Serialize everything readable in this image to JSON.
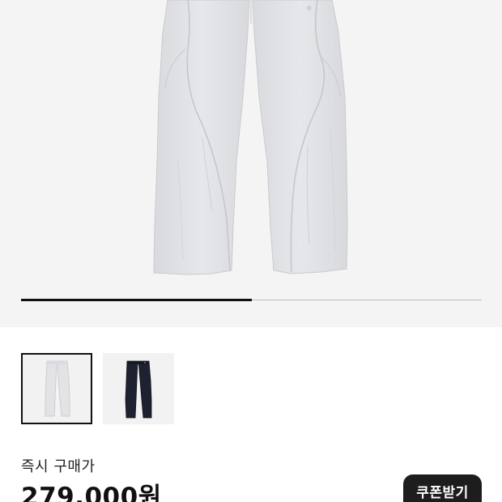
{
  "product": {
    "gallery": {
      "progress_fraction": 0.5,
      "main_image_icon": "light-gray-pants-image",
      "thumbnails": [
        {
          "name": "light-gray-pants-thumbnail",
          "color": "#e3e3e6",
          "selected": true
        },
        {
          "name": "navy-pants-thumbnail",
          "color": "#1e2130",
          "selected": false
        }
      ]
    },
    "price_label": "즉시 구매가",
    "price_value": "279,000원",
    "coupon_button_label": "쿠폰받기"
  }
}
